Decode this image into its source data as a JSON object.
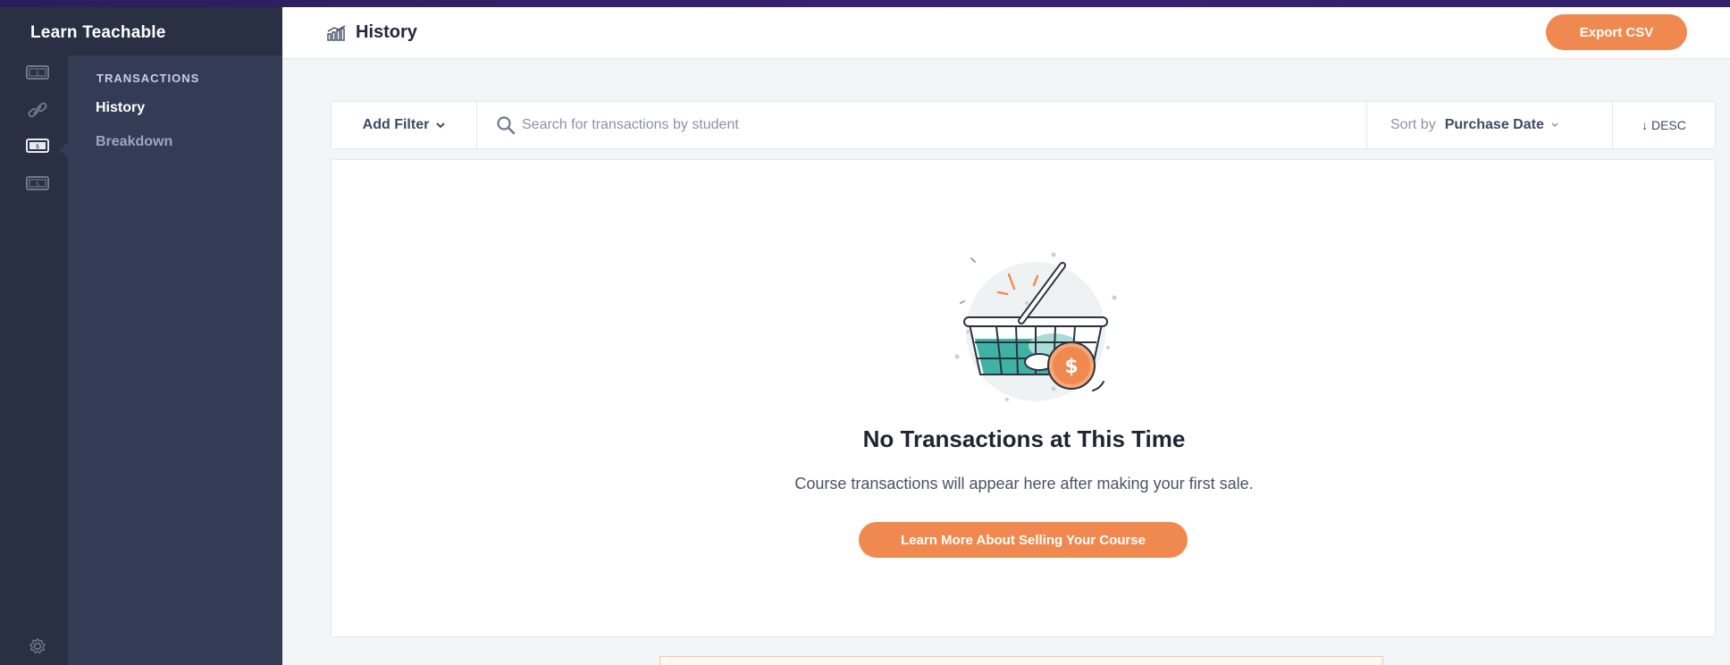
{
  "brand": "Learn Teachable",
  "sidebar": {
    "section_label": "TRANSACTIONS",
    "items": [
      {
        "label": "History"
      },
      {
        "label": "Breakdown"
      }
    ]
  },
  "rail": {
    "icons": [
      "cash-icon",
      "link-icon",
      "cash-icon",
      "cash-icon",
      "gear-icon"
    ]
  },
  "header": {
    "title": "History",
    "export_label": "Export CSV"
  },
  "filterbar": {
    "add_filter_label": "Add Filter",
    "search_placeholder": "Search for transactions by student",
    "sort_label": "Sort by",
    "sort_value": "Purchase Date",
    "order_label": "↓ DESC"
  },
  "empty_state": {
    "title": "No Transactions at This Time",
    "description": "Course transactions will appear here after making your first sale.",
    "cta_label": "Learn More About Selling Your Course"
  },
  "colors": {
    "accent": "#f0894f",
    "sidebar_bg": "#343c55",
    "rail_bg": "#2a3043",
    "teal": "#3fb3a3"
  }
}
